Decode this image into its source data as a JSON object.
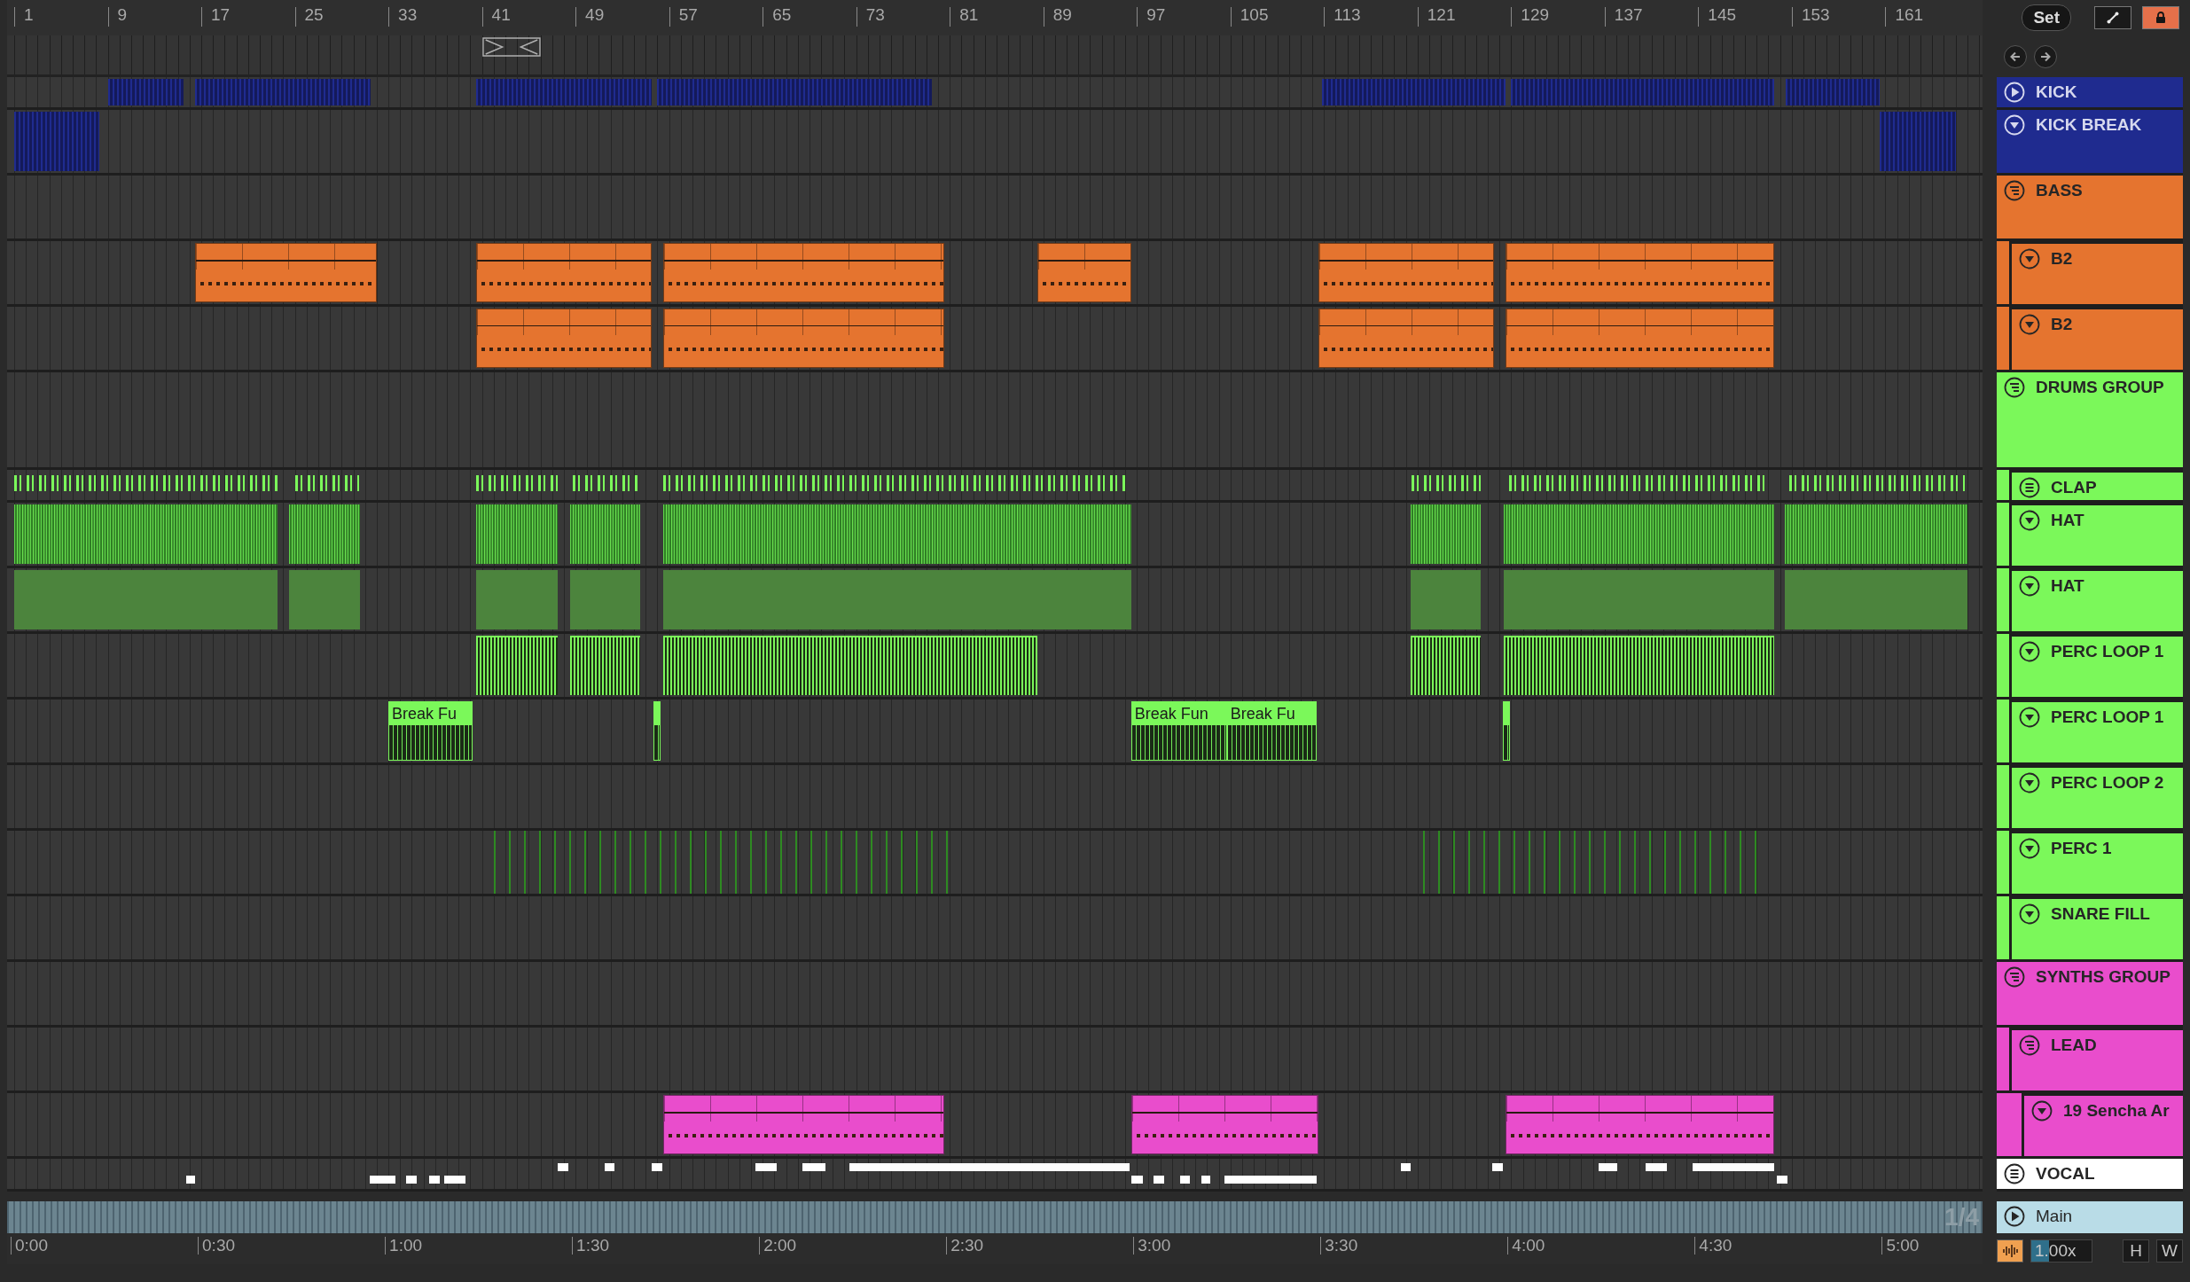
{
  "ruler": {
    "bars": [
      "1",
      "9",
      "17",
      "25",
      "33",
      "41",
      "49",
      "57",
      "65",
      "73",
      "81",
      "89",
      "97",
      "105",
      "113",
      "121",
      "129",
      "137",
      "145",
      "153",
      "161"
    ]
  },
  "controls": {
    "set_button": "Set",
    "draw_mode": {
      "on": false
    },
    "lock": {
      "on": true
    }
  },
  "tracks": [
    {
      "name": "KICK",
      "kind": "track",
      "expanded": false,
      "color": "#1f2b8f",
      "clips": [
        {
          "kind": "stripes"
        },
        {
          "kind": "stripes"
        },
        {
          "kind": "stripes"
        },
        {
          "kind": "stripes"
        },
        {
          "kind": "stripes"
        },
        {
          "kind": "stripes"
        },
        {
          "kind": "stripes"
        }
      ]
    },
    {
      "name": "KICK BREAK",
      "kind": "track",
      "expanded": true,
      "color": "#1f2b8f",
      "clips": [
        {
          "kind": "stripes"
        },
        {
          "kind": "stripes"
        }
      ]
    },
    {
      "name": "BASS",
      "kind": "group",
      "expanded": true,
      "color": "#e5742f",
      "children": [
        {
          "name": "B2",
          "kind": "track",
          "expanded": true,
          "color": "#e5742f",
          "clips": [
            {
              "kind": "midi"
            },
            {
              "kind": "midi"
            },
            {
              "kind": "midi"
            },
            {
              "kind": "midi"
            },
            {
              "kind": "midi"
            },
            {
              "kind": "midi"
            }
          ]
        },
        {
          "name": "B2",
          "kind": "track",
          "expanded": true,
          "color": "#e5742f",
          "clips": [
            {
              "kind": "midi"
            },
            {
              "kind": "midi"
            },
            {
              "kind": "midi"
            },
            {
              "kind": "midi"
            }
          ]
        }
      ]
    },
    {
      "name": "DRUMS GROUP",
      "kind": "group",
      "expanded": true,
      "color": "#7bf85a",
      "children": [
        {
          "name": "CLAP",
          "kind": "group",
          "expanded": false,
          "color": "#7bf85a",
          "clips": [
            {
              "kind": "ticks"
            },
            {
              "kind": "ticks"
            },
            {
              "kind": "ticks"
            },
            {
              "kind": "ticks"
            },
            {
              "kind": "ticks"
            },
            {
              "kind": "ticks"
            },
            {
              "kind": "ticks"
            },
            {
              "kind": "ticks"
            }
          ]
        },
        {
          "name": "HAT",
          "kind": "track",
          "expanded": true,
          "color": "#7bf85a",
          "clips": [
            {
              "kind": "wave"
            },
            {
              "kind": "wave"
            },
            {
              "kind": "wave"
            },
            {
              "kind": "wave"
            },
            {
              "kind": "wave"
            },
            {
              "kind": "wave"
            },
            {
              "kind": "wave"
            },
            {
              "kind": "wave"
            }
          ]
        },
        {
          "name": "HAT",
          "kind": "track",
          "expanded": true,
          "color": "#7bf85a",
          "clips": [
            {
              "kind": "block"
            },
            {
              "kind": "block"
            },
            {
              "kind": "block"
            },
            {
              "kind": "block"
            },
            {
              "kind": "block"
            },
            {
              "kind": "block"
            },
            {
              "kind": "block"
            },
            {
              "kind": "block"
            }
          ]
        },
        {
          "name": "PERC LOOP 1",
          "kind": "track",
          "expanded": true,
          "color": "#7bf85a",
          "clips": [
            {
              "kind": "loop"
            },
            {
              "kind": "loop"
            },
            {
              "kind": "loop"
            },
            {
              "kind": "loop"
            },
            {
              "kind": "loop"
            }
          ]
        },
        {
          "name": "PERC LOOP 1",
          "kind": "track",
          "expanded": true,
          "color": "#7bf85a",
          "clips": [
            {
              "kind": "audio",
              "name": "Break Fu"
            },
            {
              "kind": "audio"
            },
            {
              "kind": "audio",
              "name": "Break Fun"
            },
            {
              "kind": "audio",
              "name": "Break Fu"
            },
            {
              "kind": "audio"
            }
          ]
        },
        {
          "name": "PERC LOOP 2",
          "kind": "track",
          "expanded": true,
          "color": "#7bf85a"
        },
        {
          "name": "PERC 1",
          "kind": "track",
          "expanded": true,
          "color": "#7bf85a",
          "clips": [
            {
              "kind": "hits"
            },
            {
              "kind": "hits"
            }
          ]
        },
        {
          "name": "SNARE FILL",
          "kind": "track",
          "expanded": true,
          "color": "#7bf85a"
        }
      ]
    },
    {
      "name": "SYNTHS GROUP",
      "kind": "group",
      "expanded": true,
      "color": "#e94dcc",
      "children": [
        {
          "name": "LEAD",
          "kind": "group",
          "expanded": true,
          "color": "#e94dcc",
          "children": [
            {
              "name": "19 Sencha Ar",
              "kind": "track",
              "expanded": true,
              "color": "#e94dcc",
              "clips": [
                {
                  "kind": "midi"
                },
                {
                  "kind": "midi"
                },
                {
                  "kind": "midi"
                }
              ]
            }
          ]
        }
      ]
    },
    {
      "name": "VOCAL",
      "kind": "group",
      "expanded": false,
      "color": "#ffffff",
      "clips": [
        {
          "kind": "note-bottom"
        },
        {
          "kind": "note-bottom"
        },
        {
          "kind": "note-bottom"
        },
        {
          "kind": "note-bottom"
        },
        {
          "kind": "note-bottom"
        },
        {
          "kind": "note-top"
        },
        {
          "kind": "note-top"
        },
        {
          "kind": "note-top"
        },
        {
          "kind": "note-top"
        },
        {
          "kind": "note-top"
        },
        {
          "kind": "note-top"
        },
        {
          "kind": "note-bottom"
        },
        {
          "kind": "note-bottom"
        },
        {
          "kind": "note-bottom"
        },
        {
          "kind": "note-bottom"
        },
        {
          "kind": "note-bottom"
        },
        {
          "kind": "note-top"
        },
        {
          "kind": "note-top"
        },
        {
          "kind": "note-top"
        },
        {
          "kind": "note-top"
        },
        {
          "kind": "note-top"
        },
        {
          "kind": "note-bottom"
        }
      ]
    }
  ],
  "main": {
    "name": "Main",
    "kind": "track",
    "expanded": false,
    "color": "#b9dce7",
    "lane_label": "1/4"
  },
  "time_ruler": [
    "0:00",
    "0:30",
    "1:00",
    "1:30",
    "2:00",
    "2:30",
    "3:00",
    "3:30",
    "4:00",
    "4:30",
    "5:00"
  ],
  "footer": {
    "follow": {
      "on": true
    },
    "zoom": {
      "value": "1.00x",
      "level": 0.3
    },
    "buttons": [
      "H",
      "W"
    ]
  }
}
